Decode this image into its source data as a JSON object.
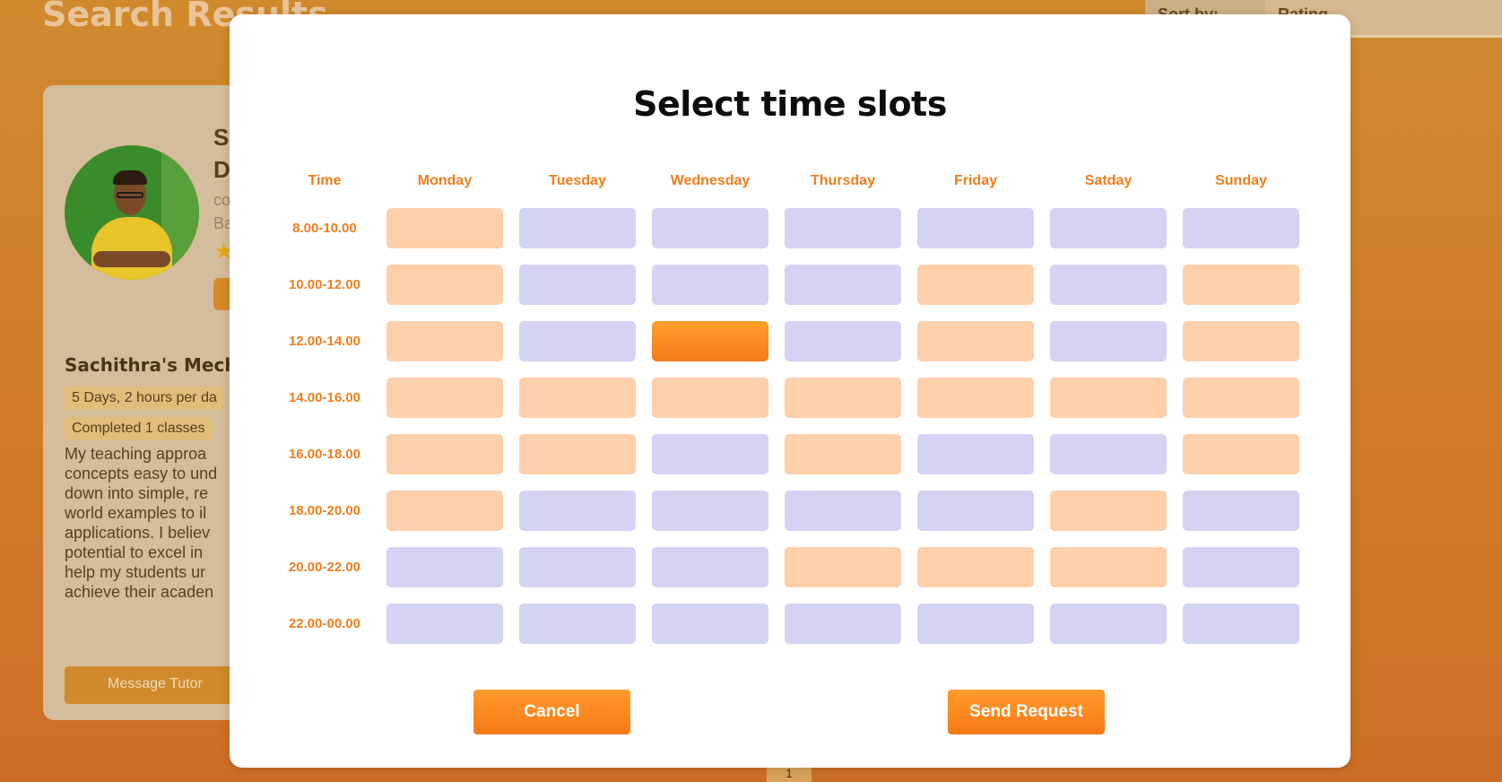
{
  "background": {
    "page_title": "Search Results",
    "sort": {
      "label": "Sort by:",
      "value": "Rating"
    },
    "tutor_card": {
      "name_partial": [
        "S",
        "D"
      ],
      "sub_partial": [
        "co",
        "Ba"
      ],
      "course_title": "Sachithra's Mecha",
      "pills": [
        "5 Days, 2 hours per da",
        "Completed 1 classes"
      ],
      "description_lines": [
        "My teaching approa",
        "concepts easy to und",
        "down into simple, re",
        "world examples to il",
        "applications. I believ",
        "potential to excel in",
        "help my students ur",
        "achieve their acaden"
      ],
      "message_button": "Message Tutor"
    },
    "pager": "1"
  },
  "modal": {
    "title": "Select time slots",
    "time_header": "Time",
    "days": [
      "Monday",
      "Tuesday",
      "Wednesday",
      "Thursday",
      "Friday",
      "Satday",
      "Sunday"
    ],
    "rows": [
      {
        "time": "8.00-10.00",
        "slots": [
          "busy",
          "available",
          "available",
          "available",
          "available",
          "available",
          "available"
        ]
      },
      {
        "time": "10.00-12.00",
        "slots": [
          "busy",
          "available",
          "available",
          "available",
          "busy",
          "available",
          "busy"
        ]
      },
      {
        "time": "12.00-14.00",
        "slots": [
          "busy",
          "available",
          "selected",
          "available",
          "busy",
          "available",
          "busy"
        ]
      },
      {
        "time": "14.00-16.00",
        "slots": [
          "busy",
          "busy",
          "busy",
          "busy",
          "busy",
          "busy",
          "busy"
        ]
      },
      {
        "time": "16.00-18.00",
        "slots": [
          "busy",
          "busy",
          "available",
          "busy",
          "available",
          "available",
          "busy"
        ]
      },
      {
        "time": "18.00-20.00",
        "slots": [
          "busy",
          "available",
          "available",
          "available",
          "available",
          "busy",
          "available"
        ]
      },
      {
        "time": "20.00-22.00",
        "slots": [
          "available",
          "available",
          "available",
          "busy",
          "busy",
          "busy",
          "available"
        ]
      },
      {
        "time": "22.00-00.00",
        "slots": [
          "available",
          "available",
          "available",
          "available",
          "available",
          "available",
          "available"
        ]
      }
    ],
    "cancel_label": "Cancel",
    "send_label": "Send Request"
  },
  "colors": {
    "accent": "#f07d1c",
    "slot_available": "#d3d4f3",
    "slot_busy": "#fdcfab",
    "slot_selected": "#f88a1e",
    "backdrop": "#d08a2c"
  }
}
